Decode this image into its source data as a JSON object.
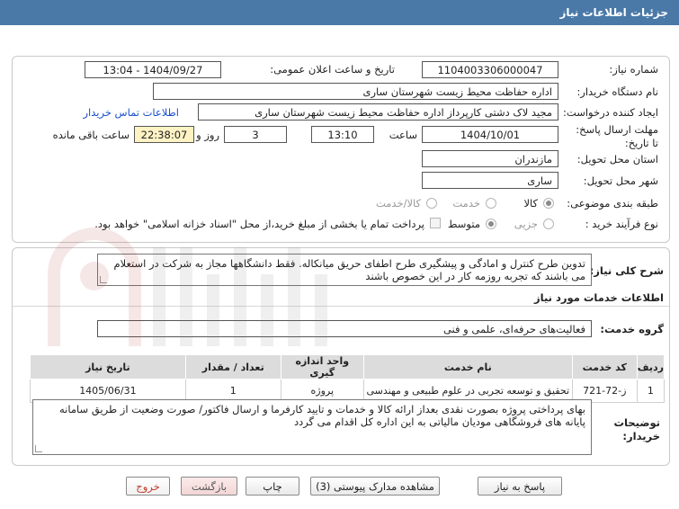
{
  "title": "جزئیات اطلاعات نیاز",
  "need_number": {
    "label": "شماره نیاز:",
    "value": "1104003306000047"
  },
  "announce_datetime": {
    "label": "تاریخ و ساعت اعلان عمومی:",
    "value": "1404/09/27 - 13:04"
  },
  "buyer_org": {
    "label": "نام دستگاه خریدار:",
    "value": "اداره حفاظت محیط زیست شهرستان ساری"
  },
  "requester": {
    "label": "ایجاد کننده درخواست:",
    "value": "مجید لاک دشتی کارپرداز اداره حفاظت محیط زیست شهرستان ساری",
    "contact_link": "اطلاعات تماس خریدار"
  },
  "deadline": {
    "label": "مهلت ارسال پاسخ: تا تاریخ:",
    "date": "1404/10/01",
    "time_label": "ساعت",
    "time": "13:10",
    "days": "3",
    "days_label": "روز و",
    "remaining": "22:38:07",
    "remaining_label": "ساعت باقی مانده"
  },
  "province": {
    "label": "استان محل تحویل:",
    "value": "مازندران"
  },
  "city": {
    "label": "شهر محل تحویل:",
    "value": "ساری"
  },
  "category": {
    "label": "طبقه بندی موضوعی:",
    "options": [
      {
        "label": "کالا",
        "selected": true
      },
      {
        "label": "خدمت",
        "selected": false
      },
      {
        "label": "کالا/خدمت",
        "selected": false
      }
    ]
  },
  "purchase_process": {
    "label": "نوع فرآیند خرید :",
    "options": [
      {
        "label": "جزیی",
        "selected": false
      },
      {
        "label": "متوسط",
        "selected": true
      }
    ],
    "note": "پرداخت تمام یا بخشی از مبلغ خرید،از محل \"اسناد خزانه اسلامی\" خواهد بود."
  },
  "general_description": {
    "label": "شرح کلی نیاز:",
    "value": "تدوین طرح کنترل و امادگی و پیشگیری طرح اطفای حریق میانکاله. فقط دانشگاهها مجاز به شرکت در استعلام می باشند که تجربه روزمه کار در این خصوص باشند"
  },
  "services_heading": "اطلاعات خدمات مورد نیاز",
  "service_group": {
    "label": "گروه خدمت:",
    "value": "فعالیت‌های حرفه‌ای، علمی و فنی"
  },
  "table": {
    "headers": [
      "ردیف",
      "کد خدمت",
      "نام خدمت",
      "واحد اندازه گیری",
      "تعداد / مقدار",
      "تاریخ نیاز"
    ],
    "rows": [
      [
        "1",
        "ز-72-721",
        "تحقیق و توسعه تجربی در علوم طبیعی و مهندسی",
        "پروژه",
        "1",
        "1405/06/31"
      ]
    ]
  },
  "buyer_notes": {
    "label": "توضیحات خریدار:",
    "value": "بهای پرداختی پروژه بصورت نقدی بعداز ارائه کالا و خدمات  و تایید کارفرما و ارسال فاکتور/ صورت وضعیت از طریق سامانه پایانه های فروشگاهی مودیان مالیاتی به این اداره کل اقدام می گردد"
  },
  "buttons": {
    "respond": "پاسخ به نیاز",
    "attachments": "مشاهده مدارک پیوستی (3)",
    "print": "چاپ",
    "back": "بازگشت",
    "exit": "خروج"
  },
  "colors": {
    "titlebar": "#4a79a8",
    "remaining_bg": "#fff3c4",
    "link": "#1a4fd1",
    "exit_text": "#c0392b"
  }
}
